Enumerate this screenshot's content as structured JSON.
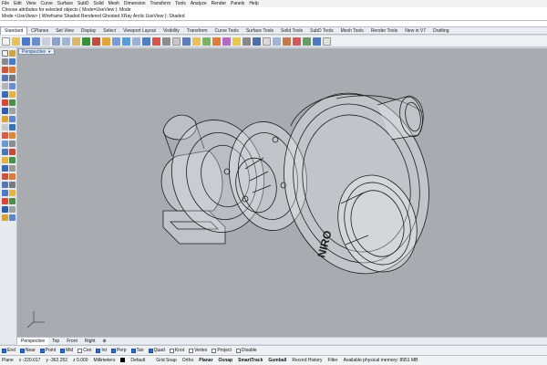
{
  "menubar": [
    "File",
    "Edit",
    "View",
    "Curve",
    "Surface",
    "SubD",
    "Solid",
    "Mesh",
    "Dimension",
    "Transform",
    "Tools",
    "Analyze",
    "Render",
    "Panels",
    "Help"
  ],
  "command": {
    "line1": "Choose attributes for selected objects ( Mode=UseView ): Mode",
    "line2": "Mode <UseView> ( Wireframe  Shaded  Rendered  Ghosted  XRay  Arctic  UseView ): Shaded"
  },
  "toolbar_tabs": [
    "Standard",
    "CPlanes",
    "Set View",
    "Display",
    "Select",
    "Viewport Layout",
    "Visibility",
    "Transform",
    "Curve Tools",
    "Surface Tools",
    "Solid Tools",
    "SubD Tools",
    "Mesh Tools",
    "Render Tools",
    "New in V7",
    "Drafting"
  ],
  "active_tab_index": 0,
  "viewport": {
    "label": "Perspective",
    "background": "#a8abb0"
  },
  "view_tabs": [
    "Perspective",
    "Top",
    "Front",
    "Right"
  ],
  "active_view_tab": 0,
  "osnaps": [
    {
      "label": "End",
      "checked": true
    },
    {
      "label": "Near",
      "checked": true
    },
    {
      "label": "Point",
      "checked": true
    },
    {
      "label": "Mid",
      "checked": true
    },
    {
      "label": "Cen",
      "checked": false
    },
    {
      "label": "Int",
      "checked": true
    },
    {
      "label": "Perp",
      "checked": true
    },
    {
      "label": "Tan",
      "checked": true
    },
    {
      "label": "Quad",
      "checked": true
    },
    {
      "label": "Knot",
      "checked": false
    },
    {
      "label": "Vertex",
      "checked": false
    },
    {
      "label": "Project",
      "checked": false
    },
    {
      "label": "Disable",
      "checked": false
    }
  ],
  "status": {
    "plane": "Plane",
    "x": "x -220.017",
    "y": "y -362.252",
    "z": "z 0.000",
    "units": "Millimeters",
    "layer": "Default",
    "grid_snap": "Grid Snap",
    "ortho": "Ortho",
    "planar": "Planar",
    "osnap": "Osnap",
    "smarttrack": "SmartTrack",
    "gumball": "Gumball",
    "record_history": "Record History",
    "filter": "Filter",
    "memory": "Available physical memory: 8951 MB"
  },
  "model_text": "NIRO"
}
